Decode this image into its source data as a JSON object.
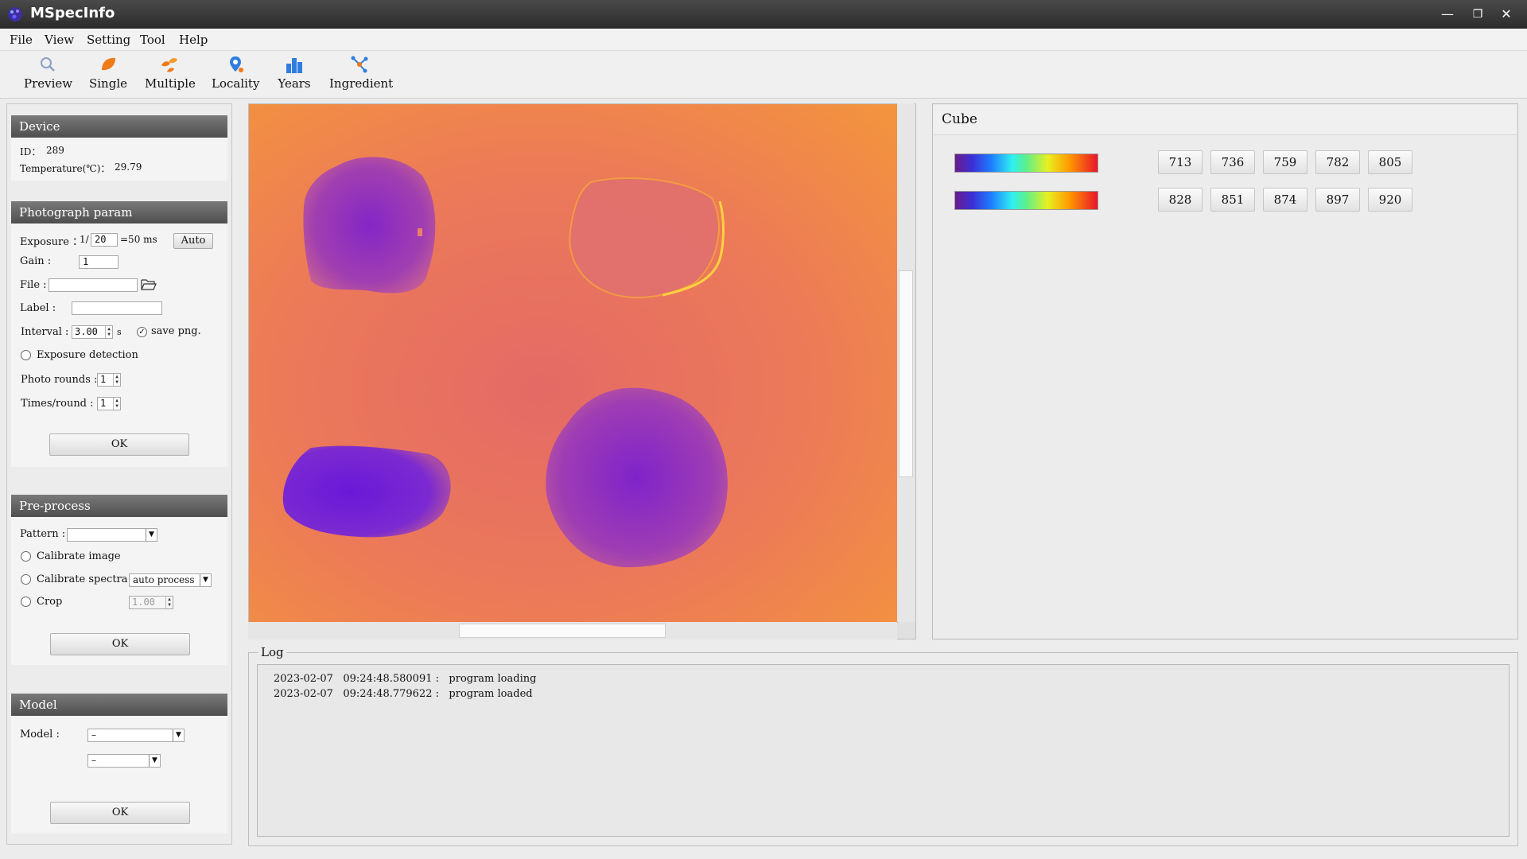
{
  "window": {
    "title": "MSpecInfo",
    "minimize": "—",
    "restore": "❐",
    "close": "✕"
  },
  "menu": [
    "File",
    "View",
    "Setting",
    "Tool",
    "Help"
  ],
  "toolbar": [
    {
      "label": "Preview",
      "icon": "magnifier-icon"
    },
    {
      "label": "Single",
      "icon": "leaf-icon"
    },
    {
      "label": "Multiple",
      "icon": "leaves-icon"
    },
    {
      "label": "Locality",
      "icon": "location-pin-icon"
    },
    {
      "label": "Years",
      "icon": "bar-chart-icon"
    },
    {
      "label": "Ingredient",
      "icon": "molecule-icon"
    }
  ],
  "device": {
    "header": "Device",
    "id_label": "ID：",
    "id_value": "289",
    "temp_label": "Temperature(℃)：",
    "temp_value": "29.79"
  },
  "photo": {
    "header": "Photograph param",
    "exposure_label": "Exposure ：",
    "exposure_prefix": "1/",
    "exposure_value": "20",
    "exposure_suffix": "=50 ms",
    "auto_label": "Auto",
    "gain_label": "Gain :",
    "gain_value": "1",
    "file_label": "File :",
    "file_value": "",
    "label_label": "Label :",
    "label_value": "",
    "interval_label": "Interval :",
    "interval_value": "3.00",
    "interval_unit": "s",
    "save_png_label": "save png.",
    "save_png_checked": true,
    "exposure_detection_label": "Exposure detection",
    "photo_rounds_label": "Photo rounds :",
    "photo_rounds_value": "1",
    "times_round_label": "Times/round :",
    "times_round_value": "1",
    "ok_label": "OK"
  },
  "preprocess": {
    "header": "Pre-process",
    "pattern_label": "Pattern :",
    "pattern_value": "",
    "calibrate_image_label": "Calibrate image",
    "calibrate_spectra_label": "Calibrate spectra",
    "calibrate_spectra_mode": "auto process",
    "crop_label": "Crop",
    "crop_value": "1.00",
    "ok_label": "OK"
  },
  "model": {
    "header": "Model",
    "model_label": "Model :",
    "model_value": "–",
    "sub_value": "–",
    "ok_label": "OK"
  },
  "cube": {
    "header": "Cube",
    "row1": [
      "713",
      "736",
      "759",
      "782",
      "805"
    ],
    "row2": [
      "828",
      "851",
      "874",
      "897",
      "920"
    ]
  },
  "colors": {
    "image_background": "#f08a4a",
    "sample_fill": "#7a2ad0"
  },
  "log": {
    "title": "Log",
    "lines": [
      "2023-02-07   09:24:48.580091 :   program loading",
      "2023-02-07   09:24:48.779622 :   program loaded"
    ]
  }
}
